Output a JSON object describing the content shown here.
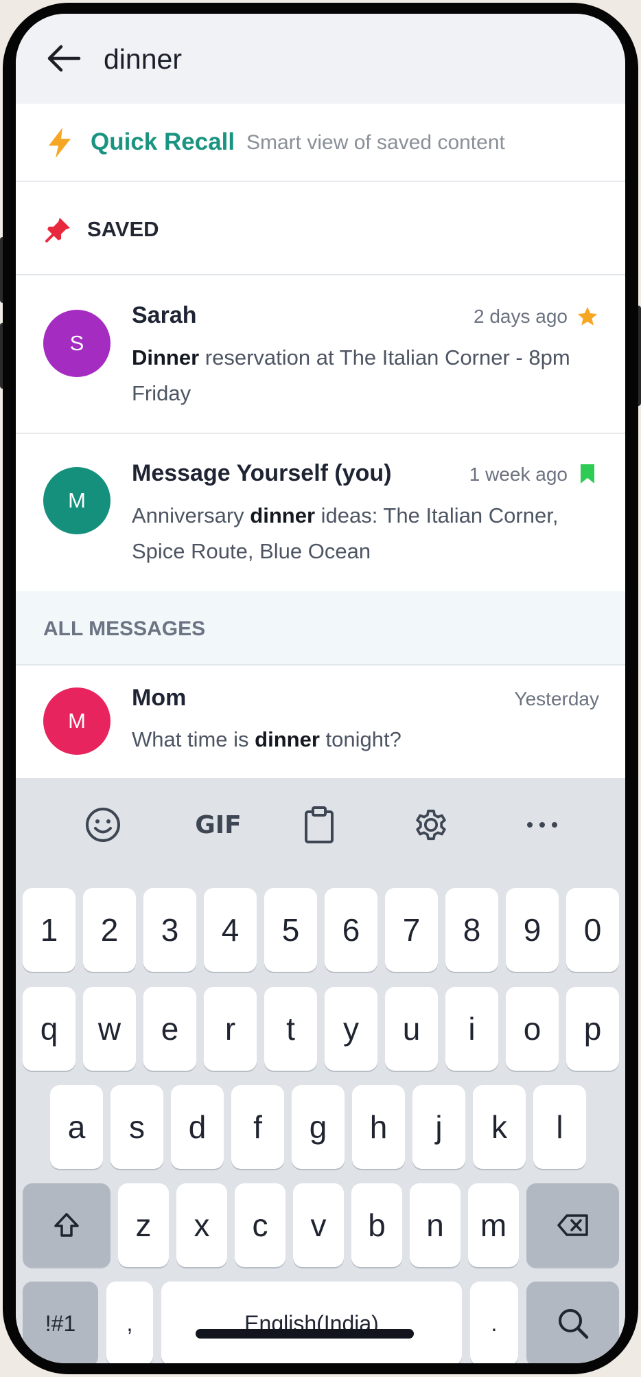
{
  "search": {
    "query": "dinner"
  },
  "quick_recall": {
    "title": "Quick Recall",
    "subtitle": "Smart view of saved content"
  },
  "saved_section": {
    "title": "SAVED"
  },
  "saved_messages": [
    {
      "avatar_letter": "S",
      "avatar_color": "#a42cc1",
      "name": "Sarah",
      "time": "2 days ago",
      "marker": "star-icon",
      "preview_bold": "Dinner",
      "preview_rest": " reservation at The Italian Corner - 8pm Friday"
    },
    {
      "avatar_letter": "M",
      "avatar_color": "#15907c",
      "name": "Message Yourself (you)",
      "time": "1 week ago",
      "marker": "bookmark-icon",
      "preview_pre": "Anniversary ",
      "preview_bold": "dinner",
      "preview_rest": " ideas: The Italian Corner, Spice Route, Blue Ocean"
    }
  ],
  "all_section": {
    "title": "ALL MESSAGES"
  },
  "all_messages": [
    {
      "avatar_letter": "M",
      "avatar_color": "#e8245f",
      "name": "Mom",
      "time": "Yesterday",
      "preview_pre": "What time is ",
      "preview_bold": "dinner",
      "preview_rest": " tonight?"
    }
  ],
  "keyboard": {
    "toolbar": {
      "gif": "GIF"
    },
    "row_numbers": [
      "1",
      "2",
      "3",
      "4",
      "5",
      "6",
      "7",
      "8",
      "9",
      "0"
    ],
    "row_top": [
      "q",
      "w",
      "e",
      "r",
      "t",
      "y",
      "u",
      "i",
      "o",
      "p"
    ],
    "row_mid": [
      "a",
      "s",
      "d",
      "f",
      "g",
      "h",
      "j",
      "k",
      "l"
    ],
    "row_bottom": [
      "z",
      "x",
      "c",
      "v",
      "b",
      "n",
      "m"
    ],
    "symbols": "!#1",
    "comma": ",",
    "space": "English(India)",
    "period": "."
  },
  "colors": {
    "accent": "#1a9480",
    "bolt": "#f5a623",
    "pin": "#e8283c",
    "star": "#f6a623",
    "bookmark": "#2ecc55"
  }
}
